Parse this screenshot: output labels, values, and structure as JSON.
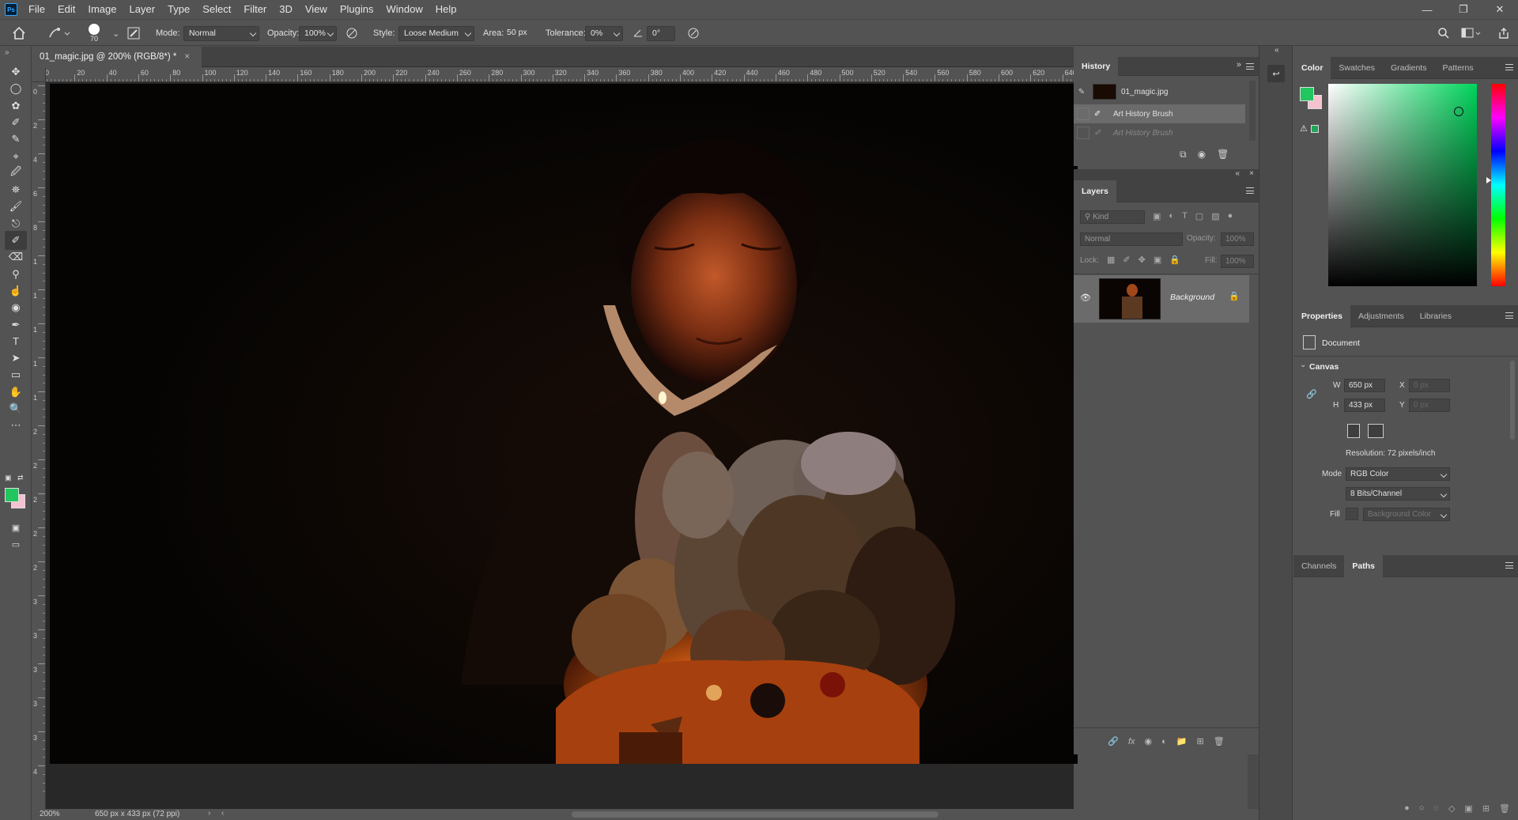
{
  "app": {
    "logo": "Ps"
  },
  "menubar": {
    "items": [
      "File",
      "Edit",
      "Image",
      "Layer",
      "Type",
      "Select",
      "Filter",
      "3D",
      "View",
      "Plugins",
      "Window",
      "Help"
    ]
  },
  "options": {
    "brush_size": "70",
    "mode_label": "Mode:",
    "mode_value": "Normal",
    "opacity_label": "Opacity:",
    "opacity_value": "100%",
    "style_label": "Style:",
    "style_value": "Loose Medium",
    "area_label": "Area:",
    "area_value": "50 px",
    "tolerance_label": "Tolerance:",
    "tolerance_value": "0%",
    "angle_value": "0°"
  },
  "document": {
    "tab_title": "01_magic.jpg @ 200% (RGB/8*) *",
    "ruler_top": [
      "0",
      "20",
      "40",
      "60",
      "80",
      "100",
      "120",
      "140",
      "160",
      "180",
      "200",
      "220",
      "240",
      "260",
      "280",
      "300",
      "320",
      "340",
      "360",
      "380",
      "400",
      "420",
      "440",
      "460",
      "480",
      "500",
      "520",
      "540",
      "560",
      "580",
      "600",
      "620",
      "640"
    ],
    "ruler_left": [
      "0",
      "2",
      "4",
      "6",
      "8",
      "1",
      "1",
      "1",
      "1",
      "1",
      "2",
      "2",
      "2",
      "2",
      "2",
      "3",
      "3",
      "3",
      "3",
      "3",
      "4"
    ],
    "zoom": "200%",
    "dimensions": "650 px x 433 px (72 ppi)"
  },
  "history": {
    "tab": "History",
    "snapshot": "01_magic.jpg",
    "states": [
      "Art History Brush",
      "Art History Brush"
    ]
  },
  "layers": {
    "tab": "Layers",
    "filter_kind": "Kind",
    "blend_mode": "Normal",
    "opacity_label": "Opacity:",
    "opacity_value": "100%",
    "lock_label": "Lock:",
    "fill_label": "Fill:",
    "fill_value": "100%",
    "layer_name": "Background"
  },
  "color_panel": {
    "tabs": [
      "Color",
      "Swatches",
      "Gradients",
      "Patterns"
    ],
    "foreground": "#22c55e",
    "background": "#f4c2cf"
  },
  "properties": {
    "tabs": [
      "Properties",
      "Adjustments",
      "Libraries"
    ],
    "doc_label": "Document",
    "section": "Canvas",
    "w_label": "W",
    "w_value": "650 px",
    "h_label": "H",
    "h_value": "433 px",
    "x_label": "X",
    "x_placeholder": "0 px",
    "y_label": "Y",
    "y_placeholder": "0 px",
    "resolution": "Resolution: 72 pixels/inch",
    "mode_label": "Mode",
    "mode_value": "RGB Color",
    "bits_value": "8 Bits/Channel",
    "fill_label": "Fill",
    "fill_value": "Background Color"
  },
  "channels_panel": {
    "tabs": [
      "Channels",
      "Paths"
    ]
  }
}
